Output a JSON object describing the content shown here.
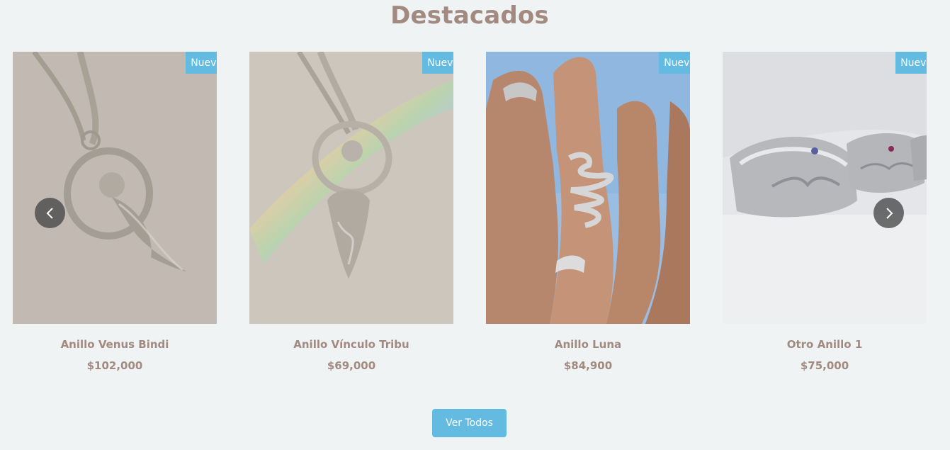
{
  "section": {
    "title": "Destacados"
  },
  "products": [
    {
      "name": "Anillo Venus Bindi",
      "price": "$102,000",
      "badge": "Nuevo",
      "image": "venus-pendant-image"
    },
    {
      "name": "Anillo Vínculo Tribu",
      "price": "$69,000",
      "badge": "Nuevo",
      "image": "goddess-pendant-rainbow-image"
    },
    {
      "name": "Anillo Luna",
      "price": "$84,900",
      "badge": "Nuevo",
      "image": "snake-ring-hand-image"
    },
    {
      "name": "Otro Anillo 1",
      "price": "$75,000",
      "badge": "Nuevo",
      "image": "eye-rings-image"
    }
  ],
  "carousel": {
    "prev_icon": "chevron-left-icon",
    "next_icon": "chevron-right-icon"
  },
  "cta": {
    "label": "Ver Todos"
  },
  "colors": {
    "accent": "#63bbe2",
    "text": "#a28a80",
    "background": "#f0f3f4"
  }
}
